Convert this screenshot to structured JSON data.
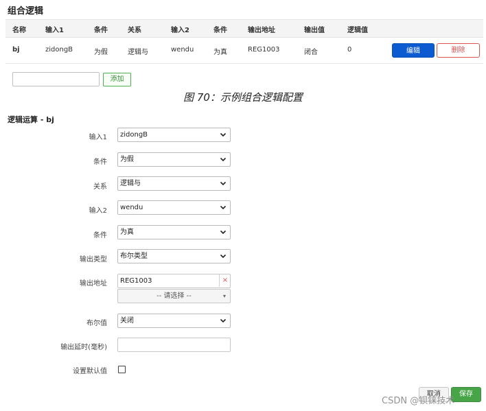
{
  "page": {
    "title": "组合逻辑",
    "caption": "图 70：示例组合逻辑配置",
    "watermark": "CSDN @钡铼技术"
  },
  "table": {
    "headers": [
      "名称",
      "输入1",
      "条件",
      "关系",
      "输入2",
      "条件",
      "输出地址",
      "输出值",
      "逻辑值"
    ],
    "rows": [
      {
        "name": "bj",
        "input1": "zidongB",
        "cond1": "为假",
        "relation": "逻辑与",
        "input2": "wendu",
        "cond2": "为真",
        "output_address": "REG1003",
        "output_value": "闭合",
        "logic_value": "0"
      }
    ],
    "edit_label": "编辑",
    "delete_label": "删除"
  },
  "add": {
    "input_value": "",
    "button_label": "添加"
  },
  "form": {
    "section_title": "逻辑运算 - bj",
    "input1": {
      "label": "输入1",
      "value": "zidongB"
    },
    "cond1": {
      "label": "条件",
      "value": "为假"
    },
    "relation": {
      "label": "关系",
      "value": "逻辑与"
    },
    "input2": {
      "label": "输入2",
      "value": "wendu"
    },
    "cond2": {
      "label": "条件",
      "value": "为真"
    },
    "output_type": {
      "label": "输出类型",
      "value": "布尔类型"
    },
    "output_address": {
      "label": "输出地址",
      "value": "REG1003",
      "clear_glyph": "×",
      "picker_placeholder": "-- 请选择 --",
      "picker_caret": "▾"
    },
    "bool_value": {
      "label": "布尔值",
      "value": "关闭"
    },
    "output_delay": {
      "label": "输出延时(毫秒)",
      "value": ""
    },
    "default_value": {
      "label": "设置默认值",
      "checked": false
    }
  },
  "actions": {
    "cancel_label": "取消",
    "save_label": "保存"
  },
  "icons": {
    "select_caret": "chevron-down-icon",
    "clear": "clear-icon",
    "checkbox": "checkbox-icon"
  },
  "colors": {
    "primary": "#0c5bd1",
    "danger": "#d9534f",
    "success": "#47a447"
  }
}
